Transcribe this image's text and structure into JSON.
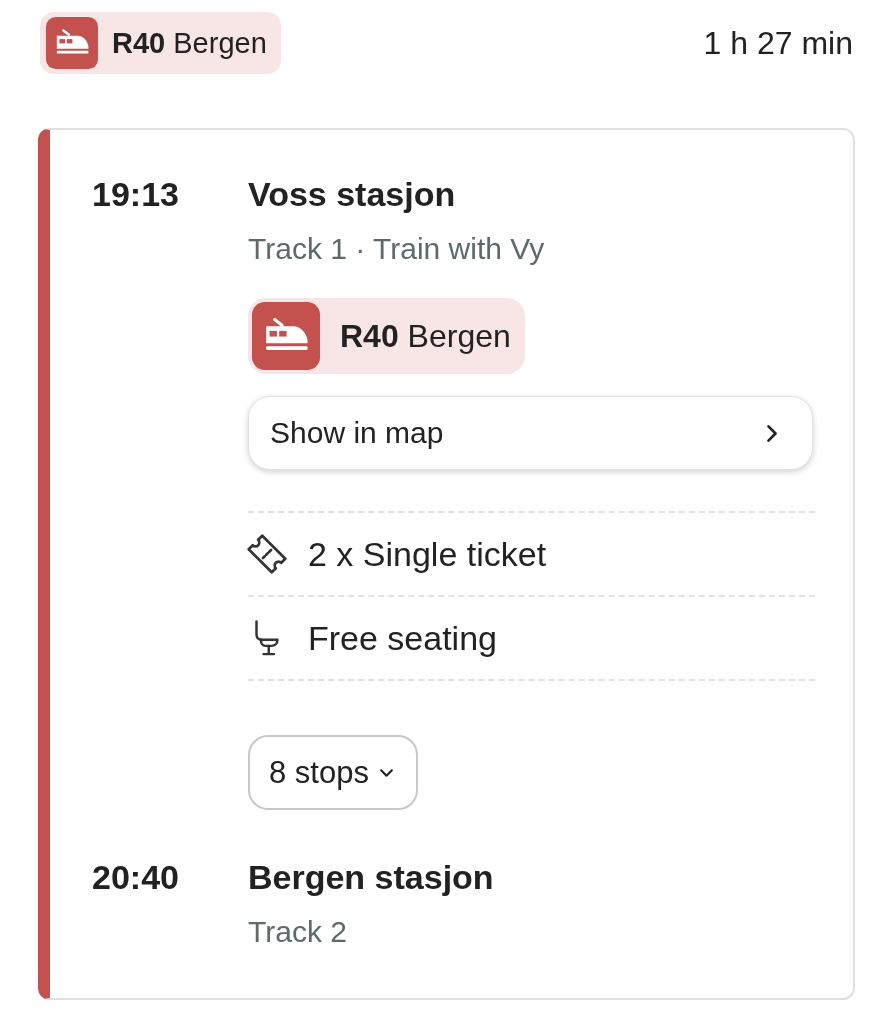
{
  "header": {
    "line_badge": "**R40** Bergen",
    "duration": "1 h 27 min"
  },
  "leg": {
    "departure": {
      "time": "19:13",
      "station": "Voss stasjon",
      "details": "Track 1 · Train with Vy"
    },
    "line_badge": "**R40** Bergen",
    "map_button": {
      "label": "Show in map"
    },
    "info": [
      {
        "kind": "ticket",
        "text": "2 x Single ticket"
      },
      {
        "kind": "seat",
        "text": "Free seating"
      }
    ],
    "stops_button": {
      "label": "8 stops",
      "expanded": false
    },
    "arrival": {
      "time": "20:40",
      "station": "Bergen stasjon",
      "details": "Track 2"
    }
  }
}
